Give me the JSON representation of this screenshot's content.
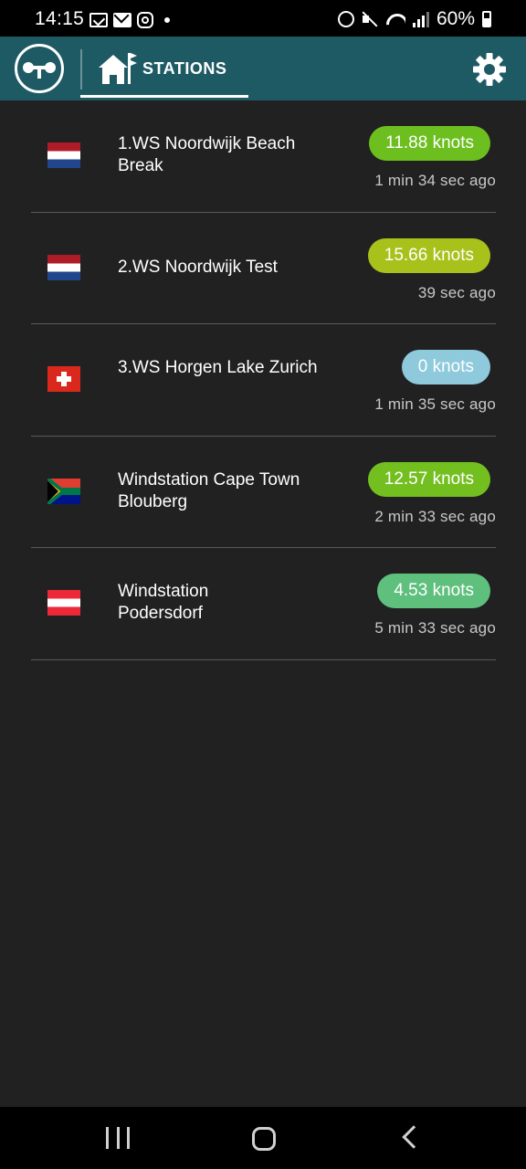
{
  "status_bar": {
    "time": "14:15",
    "battery": "60%",
    "notification_icons": [
      "message-icon",
      "mail-icon",
      "instagram-icon",
      "dot-icon"
    ],
    "system_icons": [
      "alarm-icon",
      "mute-icon",
      "wifi-icon",
      "signal-icon",
      "battery-icon"
    ]
  },
  "app_bar": {
    "logo_icon": "wind-station-logo-icon",
    "tab_label": "STATIONS",
    "tab_icon": "home-flag-icon",
    "settings_icon": "gear-icon",
    "background_color": "#1e5a64"
  },
  "stations": [
    {
      "name": "1.WS Noordwijk Beach Break",
      "flag": "netherlands",
      "speed": "11.88 knots",
      "badge_color": "#6cbf1f",
      "updated": "1 min 34 sec ago"
    },
    {
      "name": "2.WS Noordwijk Test",
      "flag": "netherlands",
      "speed": "15.66 knots",
      "badge_color": "#a9c11b",
      "updated": "39 sec ago"
    },
    {
      "name": "3.WS Horgen Lake Zurich",
      "flag": "switzerland",
      "speed": "0 knots",
      "badge_color": "#8ec9dc",
      "updated": "1 min 35 sec ago"
    },
    {
      "name": "Windstation Cape Town Blouberg",
      "flag": "south-africa",
      "speed": "12.57 knots",
      "badge_color": "#74bf20",
      "updated": "2 min 33 sec ago"
    },
    {
      "name": "Windstation Podersdorf",
      "flag": "austria",
      "speed": "4.53 knots",
      "badge_color": "#5fbf7d",
      "updated": "5 min 33 sec ago"
    }
  ],
  "nav_bar": {
    "recents_icon": "recents-icon",
    "home_icon": "home-icon",
    "back_icon": "back-icon"
  }
}
